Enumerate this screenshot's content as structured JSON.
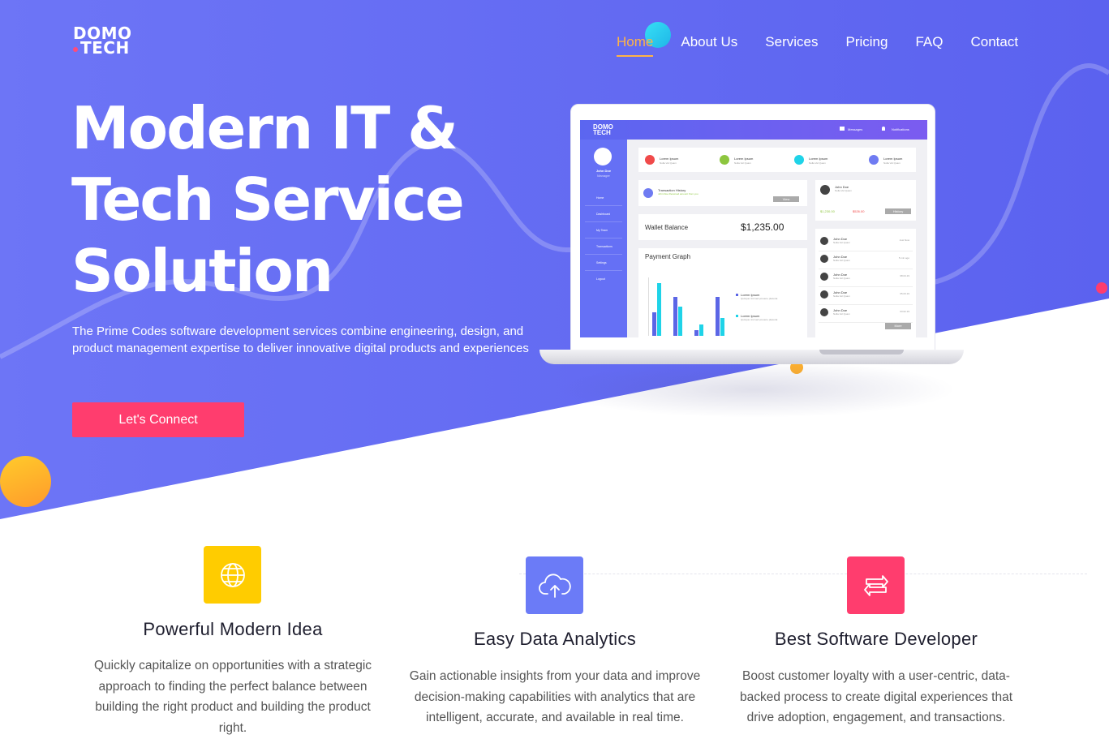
{
  "brand": {
    "line1": "DOMO",
    "line2": "TECH"
  },
  "nav": {
    "items": [
      "Home",
      "About Us",
      "Services",
      "Pricing",
      "FAQ",
      "Contact"
    ],
    "active": "Home"
  },
  "hero": {
    "title_lines": [
      "Modern IT &",
      "Tech Service",
      "Solution"
    ],
    "lead": "The Prime Codes software development services combine engineering, design, and product management expertise to deliver innovative digital products and experiences",
    "cta_label": "Let's Connect"
  },
  "dashboard": {
    "logo": {
      "line1": "DOMO",
      "line2": "TECH"
    },
    "messages": "Messages",
    "notifications": "Notifications",
    "user_name": "John Doe",
    "user_role": "Manager",
    "side_items": [
      "Home",
      "Dashboard",
      "My Team",
      "Transactions",
      "Settings",
      "Logout"
    ],
    "stat_label": "Lorem Ipsum",
    "stat_sub": "Nulla Vel Quam",
    "transaction_title": "Transaction History",
    "transaction_sub": "John Doe Received amount from you",
    "view_label": "View",
    "wallet_label": "Wallet Balance",
    "wallet_value": "$1,235.00",
    "graph_title": "Payment Graph",
    "legend_title": "Lorem Ipsum",
    "legend_text": "Quisque nisl sed posuere placerat",
    "profile_name": "John Doe",
    "profile_sub": "Nulla Vel Quam",
    "profile_up": "$1,230.00",
    "profile_down": "$526.00",
    "history_label": "History",
    "contacts": [
      "John Doe",
      "John Doe",
      "John Doe",
      "John Doe",
      "John Doe"
    ],
    "contact_sub": "Nulla Vel Quam",
    "contact_times": [
      "Just Now",
      "5 min ago",
      "08.04.19",
      "05.03.19",
      "03.02.19"
    ],
    "more_label": "More",
    "chart_data": {
      "type": "bar",
      "series": [
        {
          "values": [
            24,
            40,
            6,
            40
          ]
        },
        {
          "values": [
            54,
            30,
            12,
            18
          ]
        }
      ],
      "colors": [
        "#5b66e6",
        "#1fd3e8"
      ]
    },
    "stat_colors": [
      "#f04a4a",
      "#8dc63f",
      "#1fd3e8",
      "#6f7bf2"
    ]
  },
  "features": [
    {
      "title": "Powerful Modern Idea",
      "desc": "Quickly capitalize on opportunities with a strategic approach to finding the perfect balance between building the right product and building the product right.",
      "icon": "globe-icon",
      "color": "#ffcc00"
    },
    {
      "title": "Easy Data Analytics",
      "desc": "Gain actionable insights from your data and improve decision-making capabilities with analytics that are intelligent, accurate, and available in real time.",
      "icon": "cloud-upload-icon",
      "color": "#6b7bf7"
    },
    {
      "title": "Best Software Developer",
      "desc": "Boost customer loyalty with a user-centric, data-backed process to create digital experiences that drive adoption, engagement, and transactions.",
      "icon": "swap-arrows-icon",
      "color": "#ff3d6e"
    }
  ],
  "colors": {
    "hero_start": "#6c6ff5",
    "hero_end": "#5a63f0",
    "accent": "#ffb347",
    "cta": "#ff3d6e"
  }
}
